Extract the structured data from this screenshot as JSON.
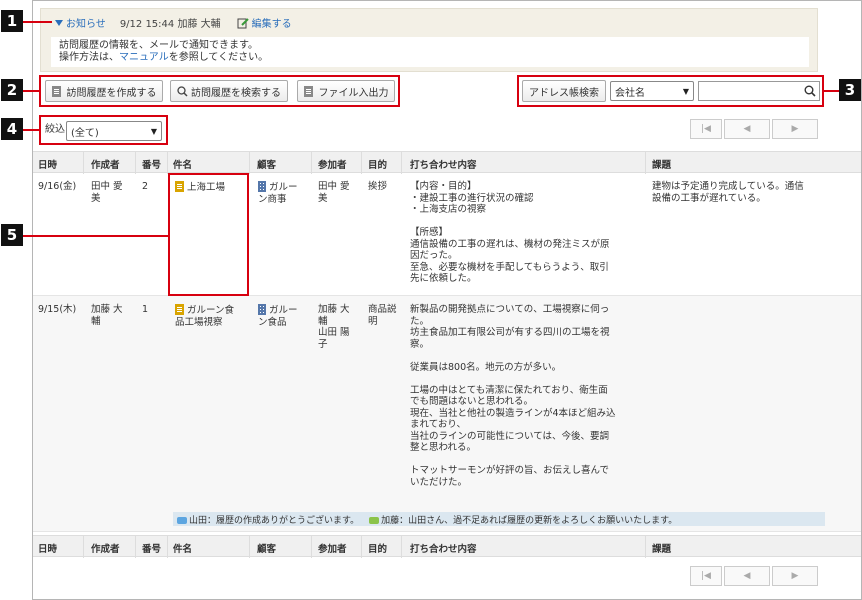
{
  "notice": {
    "toggle_label": "お知らせ",
    "meta": "9/12 15:44 加藤 大輔",
    "edit_label": "編集する",
    "line1": "訪問履歴の情報を、メールで通知できます。",
    "line2_prefix": "操作方法は、",
    "line2_link": "マニュアル",
    "line2_suffix": "を参照してください。"
  },
  "toolbar": {
    "create_label": "訪問履歴を作成する",
    "search_label": "訪問履歴を検索する",
    "file_label": "ファイル入出力",
    "address_label": "アドレス帳検索",
    "company_select": "会社名",
    "search_value": ""
  },
  "filter": {
    "label": "絞込",
    "value": "(全て)"
  },
  "pager": {
    "first": "|◀",
    "prev": "◀",
    "next": "▶"
  },
  "columns": [
    "日時",
    "作成者",
    "番号",
    "件名",
    "顧客",
    "参加者",
    "目的",
    "打ち合わせ内容",
    "課題"
  ],
  "rows": [
    {
      "date": "9/16(金)",
      "author_l1": "田中 愛",
      "author_l2": "美",
      "number": "2",
      "subject_l1": "上海工場",
      "subject_l2": "",
      "customer_l1": "ガルー",
      "customer_l2": "ン商事",
      "participants": [
        "田中 愛",
        "美"
      ],
      "purpose_l1": "挨拶",
      "purpose_l2": "",
      "content": [
        "【内容・目的】",
        "・建設工事の進行状況の確認",
        "・上海支店の視察",
        "",
        "【所感】",
        "通信設備の工事の遅れは、機材の発注ミスが原",
        "因だった。",
        "至急、必要な機材を手配してもらうよう、取引",
        "先に依頼した。"
      ],
      "issue": [
        "建物は予定通り完成している。通信",
        "設備の工事が遅れている。"
      ]
    },
    {
      "date": "9/15(木)",
      "author_l1": "加藤 大",
      "author_l2": "輔",
      "number": "1",
      "subject_l1": "ガルーン食",
      "subject_l2": "品工場視察",
      "customer_l1": "ガルー",
      "customer_l2": "ン食品",
      "participants": [
        "加藤 大",
        "輔",
        "山田 陽",
        "子"
      ],
      "purpose_l1": "商品説",
      "purpose_l2": "明",
      "content": [
        "新製品の開発拠点についての、工場視察に伺っ",
        "た。",
        "坊主食品加工有限公司が有する四川の工場を視",
        "察。",
        "",
        "従業員は800名。地元の方が多い。",
        "",
        "工場の中はとても清潔に保たれており、衛生面",
        "でも問題はないと思われる。",
        "現在、当社と他社の製造ラインが4本ほど組み込",
        "まれており、",
        "当社のラインの可能性については、今後、要調",
        "整と思われる。",
        "",
        "トマットサーモンが好評の旨、お伝えし喜んで",
        "いただけた。"
      ],
      "issue": []
    }
  ],
  "comments": [
    {
      "text": "山田：履歴の作成ありがとうございます。",
      "color": "#5ca5e0"
    },
    {
      "text": "加藤：山田さん、過不足あれば履歴の更新をよろしくお願いいたします。",
      "color": "#8bc34a"
    }
  ],
  "badges": [
    "1",
    "2",
    "3",
    "4",
    "5"
  ],
  "colors": {
    "link": "#2a6ebb",
    "annotation_red": "#d7000f",
    "badge_bg": "#111111"
  }
}
